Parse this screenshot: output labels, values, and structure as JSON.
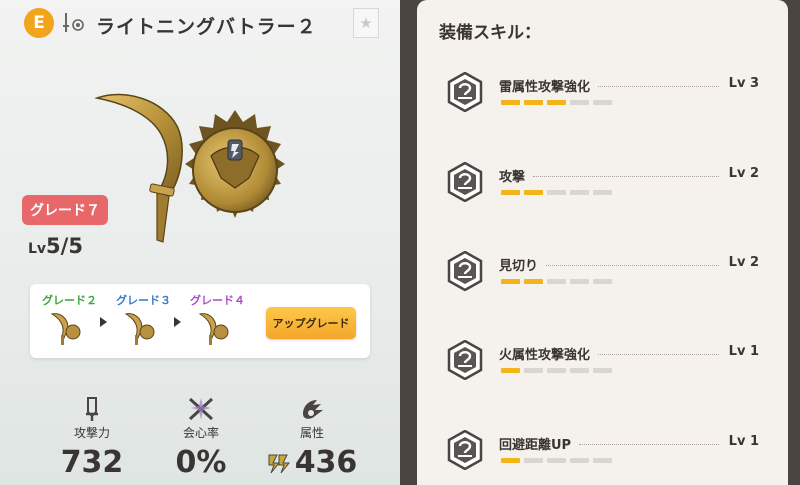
{
  "weapon": {
    "rank": "E",
    "name": "ライトニングバトラー２",
    "grade_label": "グレード７",
    "level_prefix": "Lv",
    "level": "5/5"
  },
  "upgrade": {
    "steps": [
      {
        "label": "グレード２",
        "color": "#3aa63a"
      },
      {
        "label": "グレード３",
        "color": "#3a78c8"
      },
      {
        "label": "グレード４",
        "color": "#b04ac8"
      }
    ],
    "button_label": "アップグレード"
  },
  "stats": [
    {
      "icon": "sword-icon",
      "label": "攻撃力",
      "value": "732"
    },
    {
      "icon": "critical-icon",
      "label": "会心率",
      "value": "0%"
    },
    {
      "icon": "element-icon",
      "label": "属性",
      "value": "436"
    }
  ],
  "skills_panel": {
    "title": "装備スキル：",
    "skills": [
      {
        "name": "雷属性攻撃強化",
        "level": "Lv 3",
        "filled": 3,
        "total": 5
      },
      {
        "name": "攻撃",
        "level": "Lv 2",
        "filled": 2,
        "total": 5
      },
      {
        "name": "見切り",
        "level": "Lv 2",
        "filled": 2,
        "total": 5
      },
      {
        "name": "火属性攻撃強化",
        "level": "Lv 1",
        "filled": 1,
        "total": 5
      },
      {
        "name": "回避距離UP",
        "level": "Lv 1",
        "filled": 1,
        "total": 5
      }
    ]
  },
  "colors": {
    "rank_badge": "#f2a41c",
    "grade_badge": "#e8686a",
    "skill_bar_on": "#f2b418",
    "skill_bar_off": "#d9d6d2"
  }
}
